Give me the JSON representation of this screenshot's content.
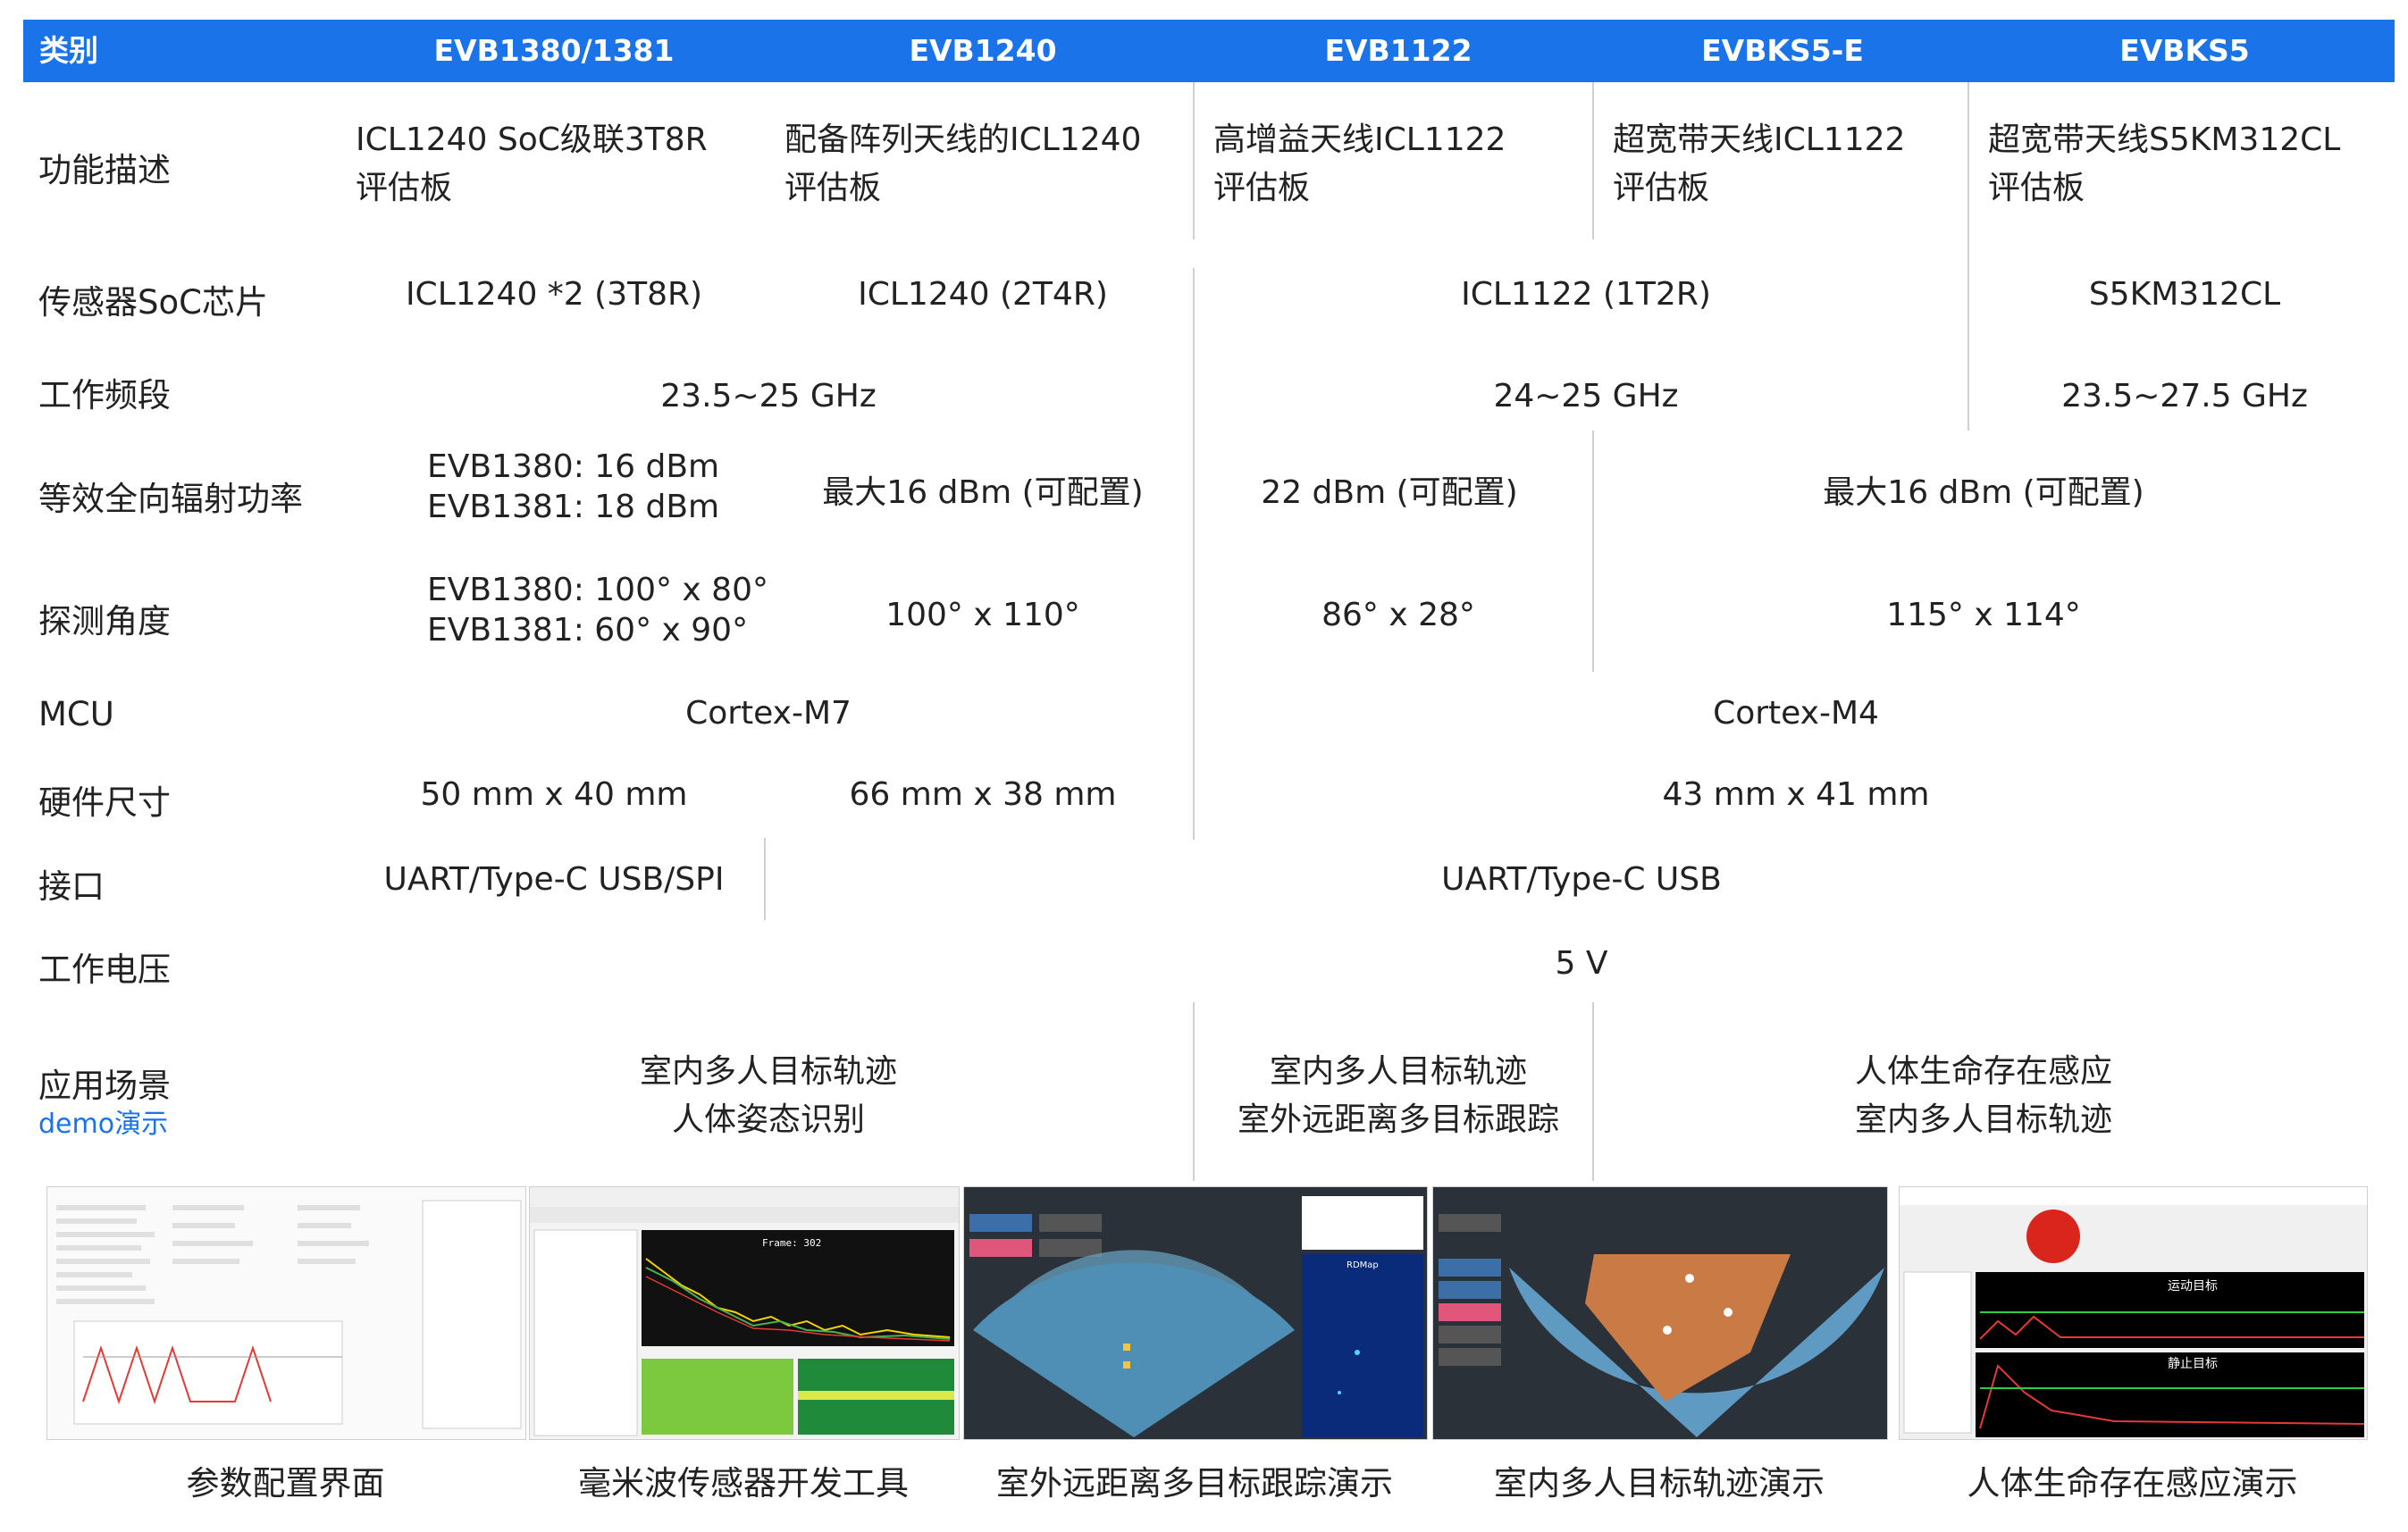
{
  "header": {
    "category": "类别",
    "cols": [
      "EVB1380/1381",
      "EVB1240",
      "EVB1122",
      "EVBKS5-E",
      "EVBKS5"
    ]
  },
  "rows": {
    "func": {
      "label": "功能描述",
      "evb1380": [
        "ICL1240 SoC级联3T8R",
        "评估板"
      ],
      "evb1240": [
        "配备阵列天线的ICL1240",
        "评估板"
      ],
      "evb1122": [
        "高增益天线ICL1122",
        "评估板"
      ],
      "evbks5e": [
        "超宽带天线ICL1122",
        "评估板"
      ],
      "evbks5": [
        "超宽带天线S5KM312CL",
        "评估板"
      ]
    },
    "soc": {
      "label": "传感器SoC芯片",
      "evb1380": "ICL1240 *2 (3T8R)",
      "evb1240": "ICL1240 (2T4R)",
      "icl1122": "ICL1122 (1T2R)",
      "evbks5": "S5KM312CL"
    },
    "band": {
      "label": "工作频段",
      "left": "23.5~25 GHz",
      "mid": "24~25 GHz",
      "right": "23.5~27.5 GHz"
    },
    "eirp": {
      "label": "等效全向辐射功率",
      "evb1380": [
        "EVB1380: 16 dBm",
        "EVB1381: 18 dBm"
      ],
      "evb1240": "最大16 dBm (可配置)",
      "evb1122": "22 dBm (可配置)",
      "ks5": "最大16 dBm (可配置)"
    },
    "angle": {
      "label": "探测角度",
      "evb1380": [
        "EVB1380: 100° x 80°",
        "EVB1381: 60° x 90°"
      ],
      "evb1240": "100° x 110°",
      "evb1122": "86° x 28°",
      "ks5": "115° x 114°"
    },
    "mcu": {
      "label": "MCU",
      "left": "Cortex-M7",
      "right": "Cortex-M4"
    },
    "size": {
      "label": "硬件尺寸",
      "evb1380": "50 mm x 40 mm",
      "evb1240": "66 mm x 38 mm",
      "right": "43 mm x 41 mm"
    },
    "iface": {
      "label": "接口",
      "left": "UART/Type-C USB/SPI",
      "right": "UART/Type-C USB"
    },
    "voltage": {
      "label": "工作电压",
      "value": "5 V"
    },
    "app": {
      "label": "应用场景",
      "demo": "demo演示",
      "left": [
        "室内多人目标轨迹",
        "人体姿态识别"
      ],
      "mid": [
        "室内多人目标轨迹",
        "室外远距离多目标跟踪"
      ],
      "right": [
        "人体生命存在感应",
        "室内多人目标轨迹"
      ]
    }
  },
  "demos": [
    {
      "caption": "参数配置界面"
    },
    {
      "caption": "毫米波传感器开发工具"
    },
    {
      "caption": "室外远距离多目标跟踪演示"
    },
    {
      "caption": "室内多人目标轨迹演示"
    },
    {
      "caption": "人体生命存在感应演示"
    }
  ],
  "screens": {
    "frame": "Frame: 302",
    "moving": "运动目标",
    "static": "静止目标",
    "rdmap": "RDMap"
  },
  "colors": {
    "header": "#1a73e8",
    "demo_link": "#1a73e8"
  }
}
